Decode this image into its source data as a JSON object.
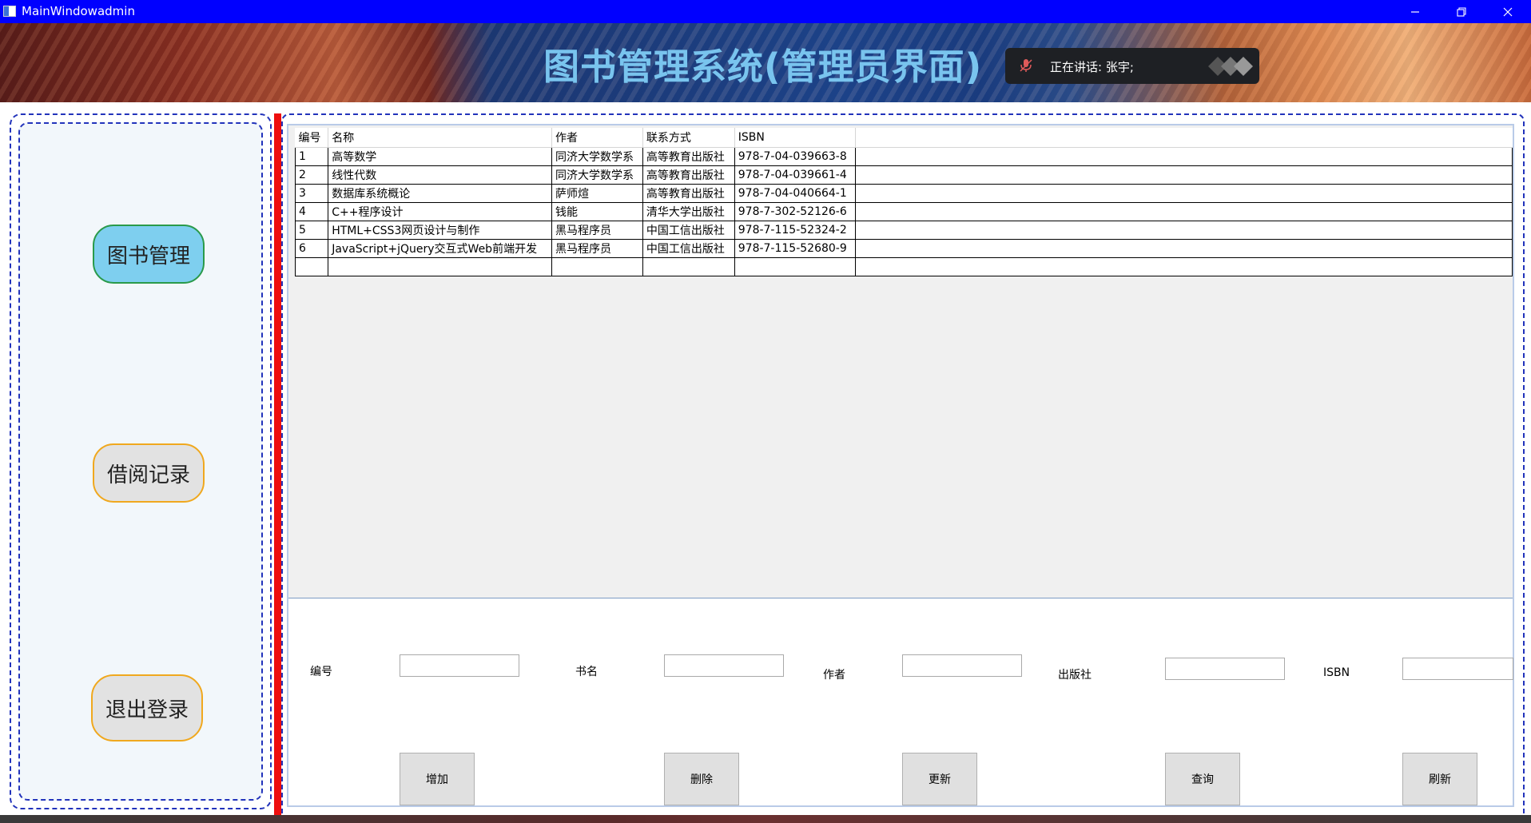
{
  "window": {
    "title": "MainWindowadmin",
    "minimize": "—",
    "restore": "❐",
    "close": "✕"
  },
  "header": {
    "title": "图书管理系统(管理员界面)",
    "speaking": "正在讲话: 张宇;"
  },
  "nav": {
    "books": "图书管理",
    "borrow": "借阅记录",
    "logout": "退出登录"
  },
  "grid": {
    "columns": [
      "编号",
      "名称",
      "作者",
      "联系方式",
      "ISBN"
    ],
    "rows": [
      [
        "1",
        "高等数学",
        "同济大学数学系",
        "高等教育出版社",
        "978-7-04-039663-8"
      ],
      [
        "2",
        "线性代数",
        "同济大学数学系",
        "高等教育出版社",
        "978-7-04-039661-4"
      ],
      [
        "3",
        "数据库系统概论",
        "萨师煊",
        "高等教育出版社",
        "978-7-04-040664-1"
      ],
      [
        "4",
        "C++程序设计",
        "钱能",
        "清华大学出版社",
        "978-7-302-52126-6"
      ],
      [
        "5",
        "HTML+CSS3网页设计与制作",
        "黑马程序员",
        "中国工信出版社",
        "978-7-115-52324-2"
      ],
      [
        "6",
        "JavaScript+jQuery交互式Web前端开发",
        "黑马程序员",
        "中国工信出版社",
        "978-7-115-52680-9"
      ]
    ]
  },
  "form": {
    "id_label": "编号",
    "name_label": "书名",
    "author_label": "作者",
    "publisher_label": "出版社",
    "isbn_label": "ISBN",
    "id_value": "",
    "name_value": "",
    "author_value": "",
    "publisher_value": "",
    "isbn_value": ""
  },
  "actions": {
    "add": "增加",
    "delete": "删除",
    "update": "更新",
    "query": "查询",
    "refresh": "刷新"
  },
  "colors": {
    "titlebar": "#0000ff",
    "title_text": "#79c4ee",
    "active_nav": "#7ecfef",
    "divider": "#ee0e0e"
  }
}
